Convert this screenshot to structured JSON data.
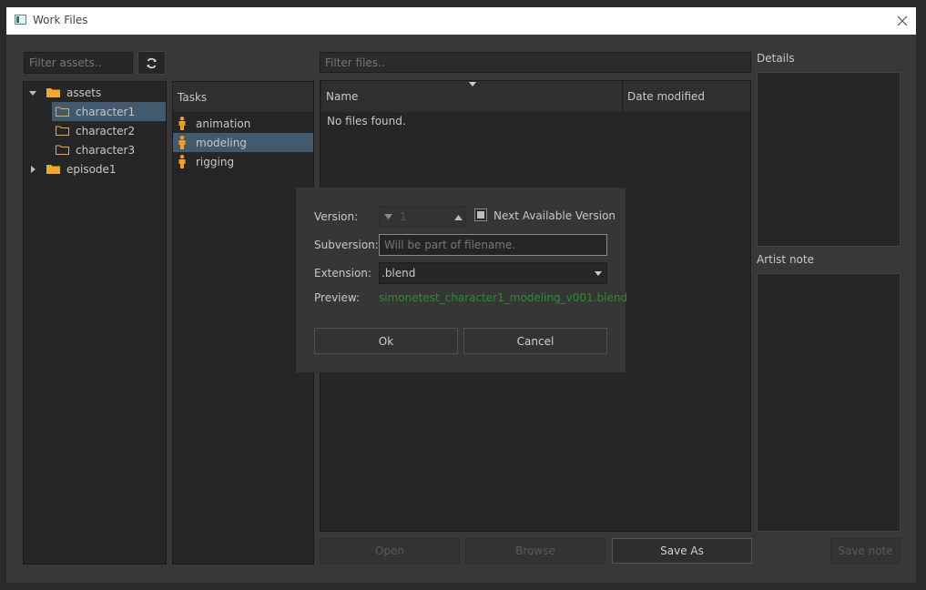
{
  "window": {
    "title": "Work Files"
  },
  "assets": {
    "filter_placeholder": "Filter assets..",
    "tree": [
      {
        "label": "assets",
        "expanded": true,
        "children": [
          "character1",
          "character2",
          "character3"
        ],
        "selected_child": "character1"
      },
      {
        "label": "episode1",
        "expanded": false
      }
    ]
  },
  "tasks": {
    "header": "Tasks",
    "items": [
      {
        "label": "animation",
        "selected": false
      },
      {
        "label": "modeling",
        "selected": true
      },
      {
        "label": "rigging",
        "selected": false
      }
    ]
  },
  "files": {
    "filter_placeholder": "Filter files..",
    "columns": [
      "Name",
      "Date modified"
    ],
    "empty_text": "No files found.",
    "buttons": {
      "open": "Open",
      "browse": "Browse",
      "save_as": "Save As"
    }
  },
  "details": {
    "details_label": "Details",
    "artist_note_label": "Artist note",
    "save_note": "Save note"
  },
  "dialog": {
    "version_label": "Version:",
    "version_value": "1",
    "next_available_label": "Next Available Version",
    "next_available_checked": true,
    "subversion_label": "Subversion:",
    "subversion_placeholder": "Will be part of filename.",
    "extension_label": "Extension:",
    "extension_value": ".blend",
    "preview_label": "Preview:",
    "preview_value": "simonetest_character1_modeling_v001.blend",
    "ok_label": "Ok",
    "cancel_label": "Cancel"
  },
  "colors": {
    "folder": "#f0a830",
    "task_icon": "#f0a020",
    "selection": "#415a6e",
    "preview_text": "#2e8b2e"
  }
}
